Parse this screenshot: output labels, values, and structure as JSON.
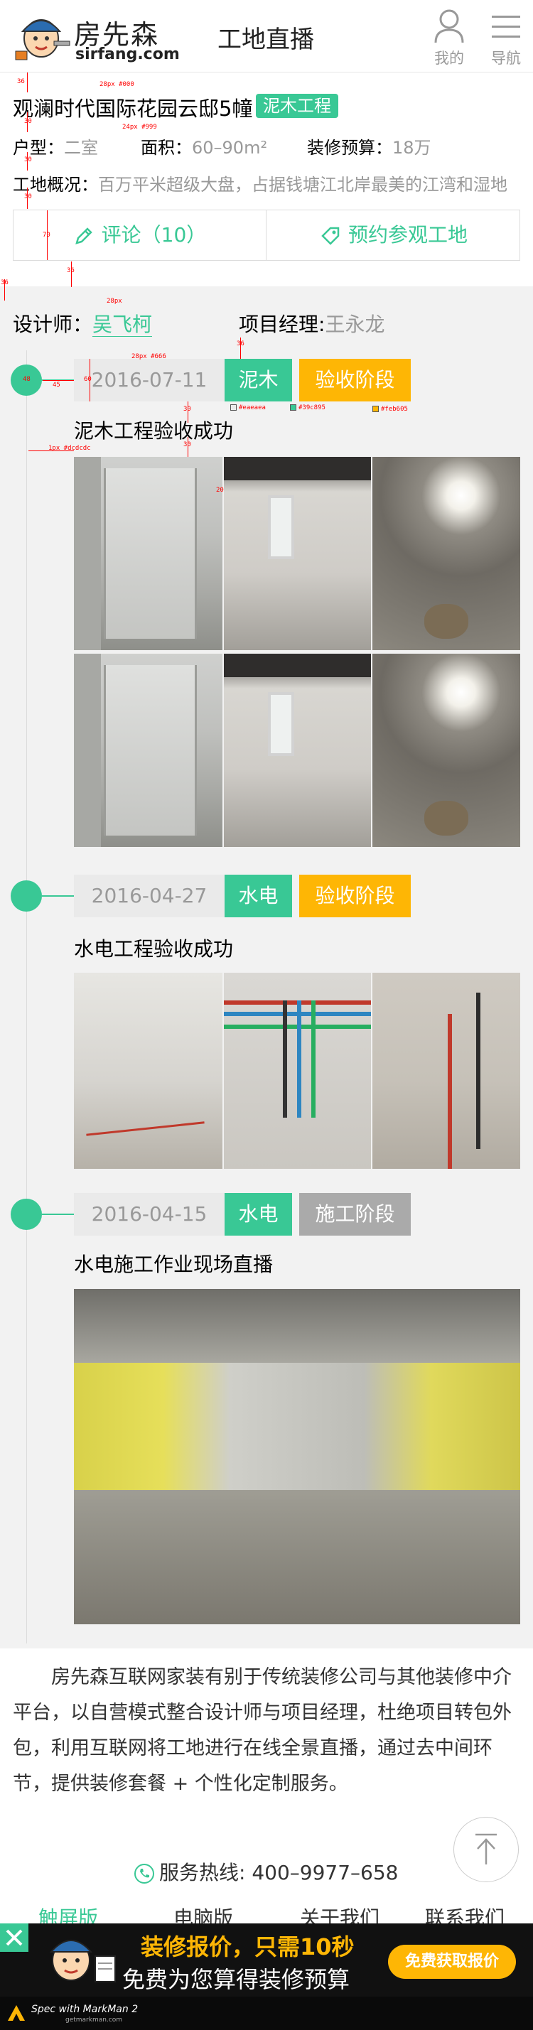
{
  "header": {
    "brand_cn": "房先森",
    "brand_en": "sirfang.com",
    "page_title": "工地直播",
    "user_label": "我的",
    "menu_label": "导航"
  },
  "project": {
    "title": "观澜时代国际花园云邸5幢",
    "stage_tag": "泥木工程",
    "layout_label": "户型：",
    "layout_value": "二室",
    "area_label": "面积：",
    "area_value": "60–90m²",
    "budget_label": "装修预算：",
    "budget_value": "18万",
    "overview_label": "工地概况：",
    "overview_value": "百万平米超级大盘，占据钱塘江北岸最美的江湾和湿地",
    "comment_label": "评论（10）",
    "visit_label": "预约参观工地"
  },
  "staff": {
    "designer_label": "设计师：",
    "designer_name": "吴飞柯",
    "manager_label": "项目经理:",
    "manager_name": "王永龙"
  },
  "timeline": [
    {
      "date": "2016-07-11",
      "type": "泥木",
      "phase": "验收阶段",
      "title": "泥木工程验收成功"
    },
    {
      "date": "2016-04-27",
      "type": "水电",
      "phase": "验收阶段",
      "title": "水电工程验收成功"
    },
    {
      "date": "2016-04-15",
      "type": "水电",
      "phase": "施工阶段",
      "title": "水电施工作业现场直播"
    }
  ],
  "intro": "房先森互联网家装有别于传统装修公司与其他装修中介平台，以自营模式整合设计师与项目经理，杜绝项目转包外包，利用互联网将工地进行在线全景直播，通过去中间环节，提供装修套餐 + 个性化定制服务。",
  "footer": {
    "hotline": "服务热线: 400–9977–658",
    "nav": [
      "触屏版",
      "电脑版",
      "关于我们",
      "联系我们"
    ]
  },
  "banner": {
    "line1": "装修报价，只需10秒",
    "line2": "免费为您算得装修预算",
    "button": "免费获取报价"
  },
  "spec_bar": {
    "text": "Spec with MarkMan 2",
    "sub": "getmarkman.com"
  },
  "annotations": {
    "a1": "36",
    "a2": "28px #000",
    "a3": "30",
    "a4": "24px #999",
    "a5": "30",
    "a6": "30",
    "a7": "70",
    "a8": "36",
    "a9": "36",
    "a10": "28px",
    "a11": "36",
    "a12": "28px #666",
    "a13": "48",
    "a14": "45",
    "a15": "60",
    "a16": "#eaeaea",
    "a17": "#39c895",
    "a18": "#feb605",
    "a19": "30",
    "a20": "30",
    "a21": "1px #dcdcdc",
    "a22": "20"
  },
  "colors": {
    "accent": "#39c895",
    "accept": "#feb605",
    "build": "#aaaaaa",
    "date_bg": "#eaeaea",
    "line": "#dcdcdc"
  }
}
